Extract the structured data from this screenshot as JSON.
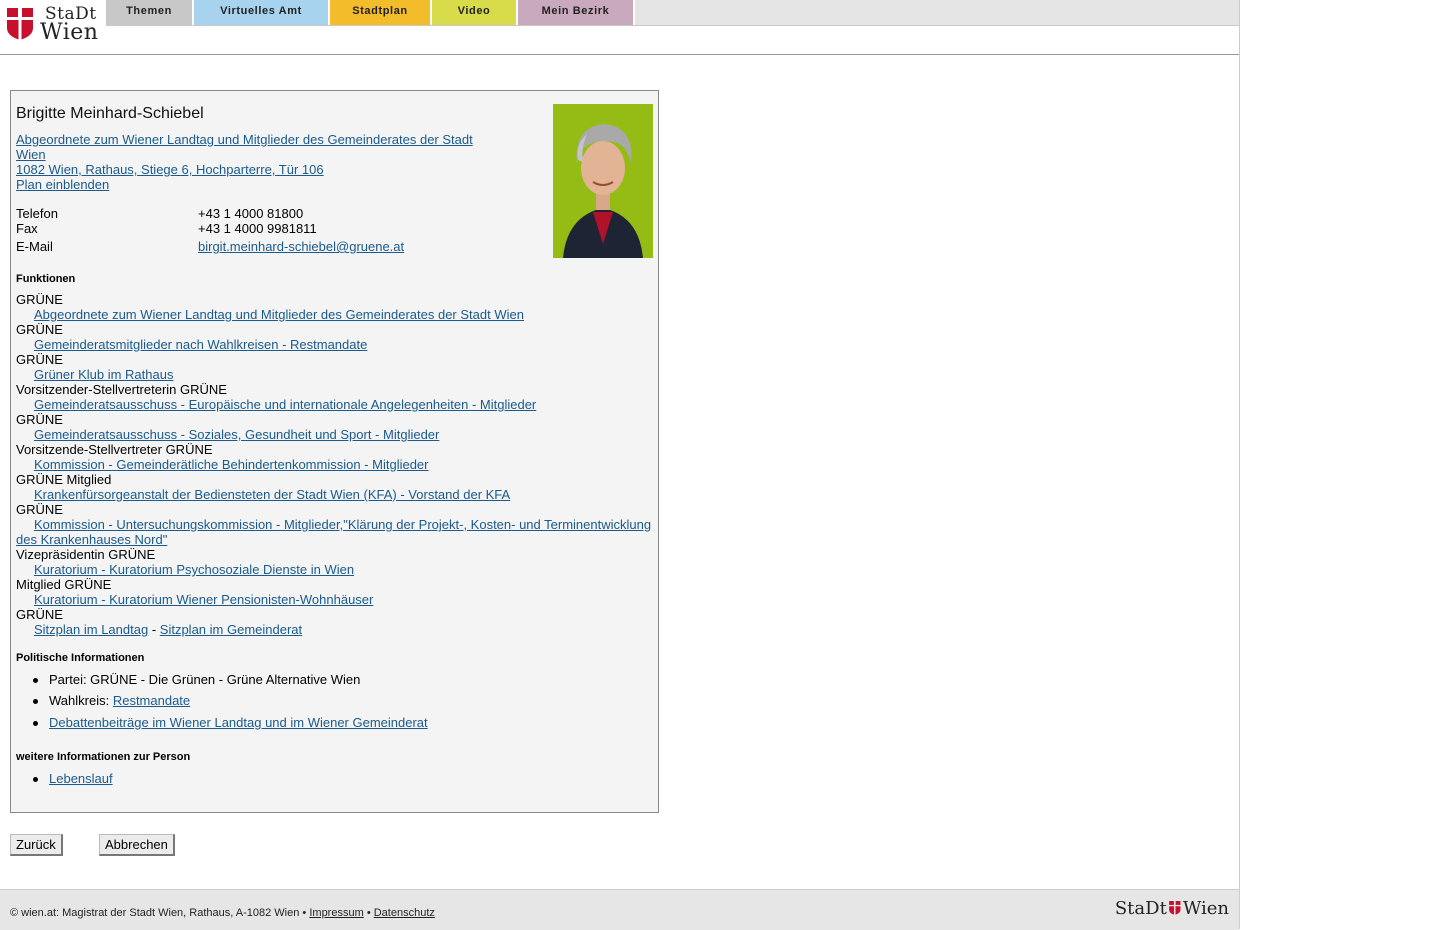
{
  "brand": {
    "stadt": "StaDt",
    "wien": "Wien",
    "colors": {
      "red": "#c8102e"
    }
  },
  "nav": {
    "tabs": [
      {
        "label": "Themen",
        "color": "#c8c8c8"
      },
      {
        "label": "Virtuelles Amt",
        "color": "#a7d3ef"
      },
      {
        "label": "Stadtplan",
        "color": "#f3bc2a"
      },
      {
        "label": "Video",
        "color": "#d8dc4a"
      },
      {
        "label": "Mein Bezirk",
        "color": "#c9a9bd"
      }
    ]
  },
  "person": {
    "name": "Brigitte Meinhard-Schiebel",
    "role_line1": "Abgeordnete zum Wiener Landtag und Mitglieder des Gemeinderates der Stadt",
    "role_line2": "Wien",
    "address": "1082 Wien, Rathaus, Stiege 6, Hochparterre, Tür 106",
    "map_link": "Plan einblenden",
    "contact": {
      "phone_label": "Telefon",
      "phone": "+43 1 4000 81800",
      "fax_label": "Fax",
      "fax": "+43 1 4000 9981811",
      "email_label": "E-Mail",
      "email": "birgit.meinhard-schiebel@gruene.at"
    }
  },
  "functions": {
    "heading": "Funktionen",
    "items": [
      {
        "prefix": "GRÜNE",
        "link": "Abgeordnete zum Wiener Landtag und Mitglieder des Gemeinderates der Stadt Wien"
      },
      {
        "prefix": "GRÜNE",
        "link": "Gemeinderatsmitglieder nach Wahlkreisen - Restmandate"
      },
      {
        "prefix": "GRÜNE",
        "link": "Grüner Klub im Rathaus"
      },
      {
        "prefix": "Vorsitzender-Stellvertreterin GRÜNE",
        "link": "Gemeinderatsausschuss - Europäische und internationale Angelegenheiten - Mitglieder"
      },
      {
        "prefix": "GRÜNE",
        "link": "Gemeinderatsausschuss - Soziales, Gesundheit und Sport - Mitglieder"
      },
      {
        "prefix": "Vorsitzende-Stellvertreter GRÜNE",
        "link": "Kommission - Gemeinderätliche Behindertenkommission - Mitglieder"
      },
      {
        "prefix": "GRÜNE Mitglied",
        "link": "Krankenfürsorgeanstalt der Bediensteten der Stadt Wien (KFA) - Vorstand der KFA"
      },
      {
        "prefix": "GRÜNE",
        "link_line1": "Kommission - Untersuchungskommission - Mitglieder,\"Klärung der Projekt-, Kosten- und Terminentwicklung",
        "link_line2": "des Krankenhauses Nord\""
      },
      {
        "prefix": "Vizepräsidentin GRÜNE",
        "link": "Kuratorium - Kuratorium Psychosoziale Dienste in Wien"
      },
      {
        "prefix": "Mitglied GRÜNE",
        "link": "Kuratorium - Kuratorium Wiener Pensionisten-Wohnhäuser"
      },
      {
        "prefix": "GRÜNE"
      }
    ],
    "seat_landtag": "Sitzplan im Landtag",
    "seat_sep": "-",
    "seat_gemeinderat": "Sitzplan im Gemeinderat"
  },
  "political": {
    "heading": "Politische Informationen",
    "party": "Partei: GRÜNE - Die Grünen - Grüne Alternative Wien",
    "wahlkreis_label": "Wahlkreis:",
    "wahlkreis_link": "Restmandate",
    "debates": "Debattenbeiträge im Wiener Landtag und im Wiener Gemeinderat"
  },
  "more": {
    "heading": "weitere Informationen zur Person",
    "cv": "Lebenslauf"
  },
  "buttons": {
    "back": "Zurück",
    "cancel": "Abbrechen"
  },
  "footer": {
    "copyright": "© wien.at: Magistrat der Stadt Wien, Rathaus, A-1082 Wien",
    "bullet": "•",
    "impressum": "Impressum",
    "datenschutz": "Datenschutz",
    "logo_stadt": "StaDt",
    "logo_wien": "Wien"
  }
}
